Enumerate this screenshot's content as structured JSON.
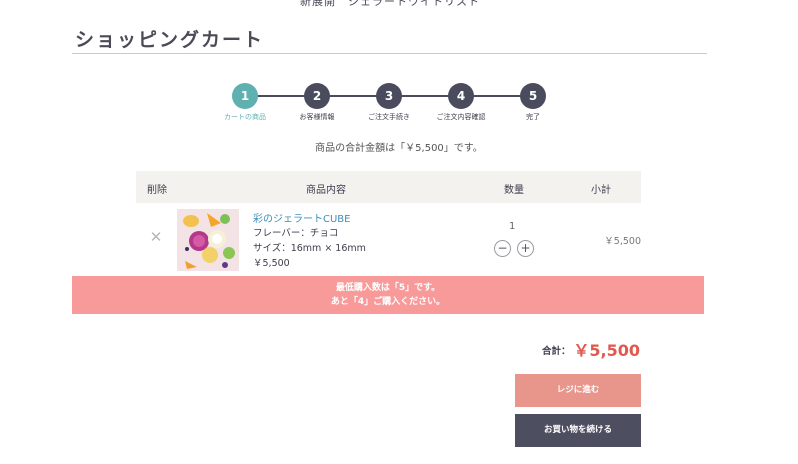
{
  "top_breadcrumb_partial": "新展開　ジェラートワイトリスト",
  "page": {
    "title": "ショッピングカート"
  },
  "stepper": {
    "steps": [
      {
        "number": "1",
        "label": "カートの商品"
      },
      {
        "number": "2",
        "label": "お客様情報"
      },
      {
        "number": "3",
        "label": "ご注文手続き"
      },
      {
        "number": "4",
        "label": "ご注文内容確認"
      },
      {
        "number": "5",
        "label": "完了"
      }
    ],
    "active_step": 1,
    "colors": {
      "active": "#5fb0b0",
      "inactive": "#4b4b5e"
    }
  },
  "total_notice": "商品の合計金額は「￥5,500」です。",
  "table": {
    "headers": {
      "delete": "削除",
      "product": "商品内容",
      "quantity": "数量",
      "subtotal": "小計"
    },
    "rows": [
      {
        "name": "彩のジェラートCUBE",
        "flavor": "フレーバー：チョコ",
        "size": "サイズ：16mm × 16mm",
        "price": "￥5,500",
        "quantity": "1",
        "subtotal": "￥5,500"
      }
    ]
  },
  "alert": {
    "line1": "最低購入数は「5」です。",
    "line2": "あと「4」ご購入ください。",
    "color": "#f99a9a"
  },
  "summary": {
    "total_label": "合計：",
    "total_value": "￥5,500",
    "total_color": "#e0584f"
  },
  "buttons": {
    "checkout": "レジに進む",
    "continue": "お買い物を続ける",
    "checkout_color": "#e8958b",
    "continue_color": "#4e4e61"
  }
}
